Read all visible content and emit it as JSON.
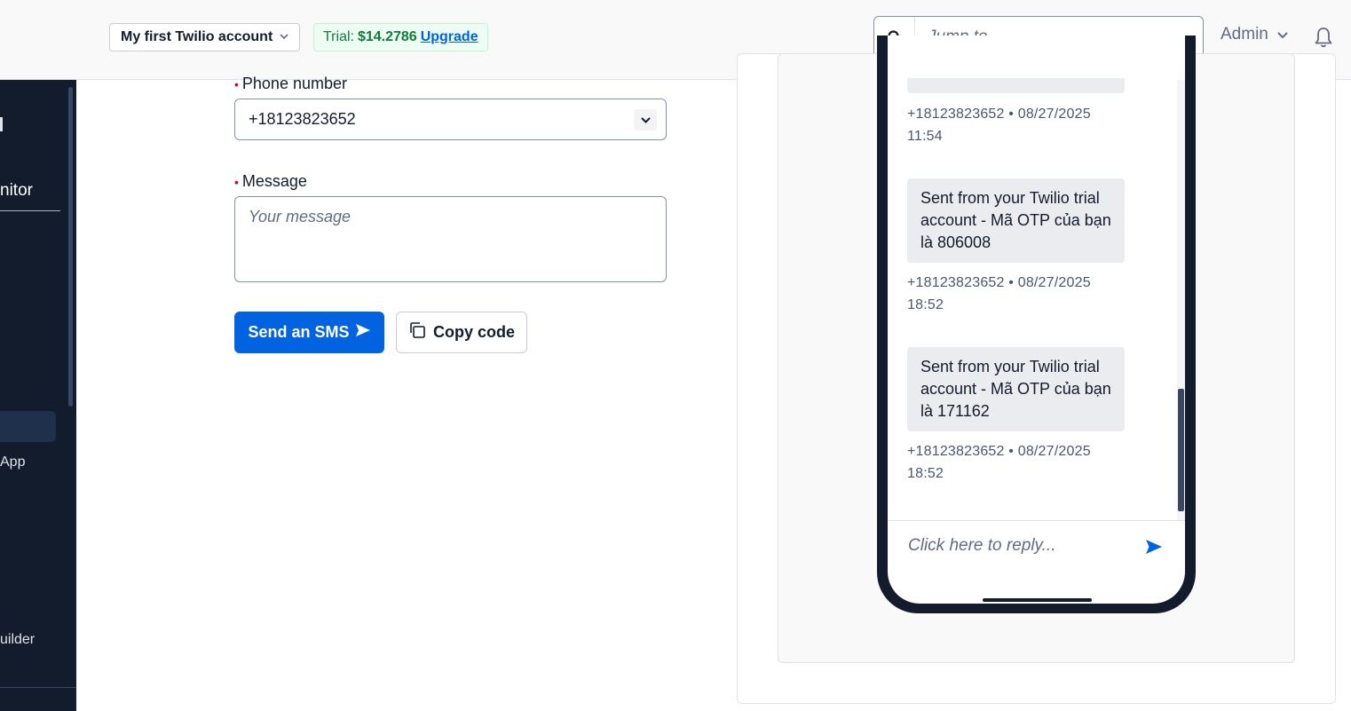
{
  "topbar": {
    "account_name": "My first Twilio account",
    "trial_label": "Trial:",
    "trial_amount": "$14.2786",
    "upgrade_label": "Upgrade",
    "search_placeholder": "Jump to...",
    "user_menu_label": "Admin"
  },
  "sidebar": {
    "items": [
      {
        "label": "nitor"
      },
      {
        "label": "App"
      },
      {
        "label": "uilder"
      }
    ]
  },
  "form": {
    "phone_label": "Phone number",
    "phone_value": "+18123823652",
    "message_label": "Message",
    "message_placeholder": "Your message",
    "send_button_label": "Send an SMS",
    "copy_button_label": "Copy code"
  },
  "preview": {
    "messages": [
      {
        "text": "",
        "meta_line1": "+18123823652 • 08/27/2025",
        "meta_line2": "11:54"
      },
      {
        "text": "Sent from your Twilio trial account - Mã OTP của bạn là 806008",
        "meta_line1": "+18123823652 • 08/27/2025",
        "meta_line2": "18:52"
      },
      {
        "text": "Sent from your Twilio trial account - Mã OTP của bạn là 171162",
        "meta_line1": "+18123823652 • 08/27/2025",
        "meta_line2": "18:52"
      }
    ],
    "reply_placeholder": "Click here to reply..."
  },
  "colors": {
    "primary": "#0263e0",
    "sidebar_bg": "#121c2d",
    "trial_green": "#0e7c3a",
    "required_red": "#d6001c"
  }
}
